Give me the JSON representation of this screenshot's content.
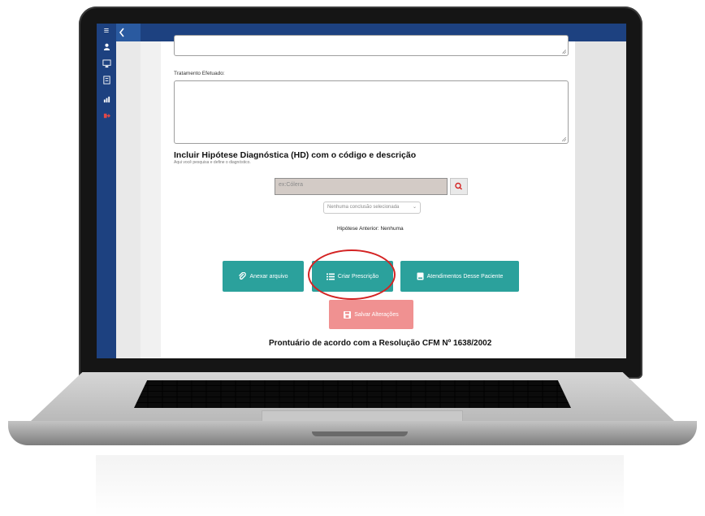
{
  "sidebar": {
    "icons": [
      "menu-icon",
      "user-icon",
      "monitor-icon",
      "records-icon",
      "chart-icon",
      "logout-icon"
    ]
  },
  "form": {
    "treatment_label": "Tratamento Efetuado:",
    "hd_title": "Incluir Hipótese Diagnóstica (HD) com o código e descrição",
    "hd_subtitle": "Aqui você pesquisa e define o diagnóstico.",
    "search_placeholder": "ex:Cólera",
    "conclusion_select": "Nenhuma conclusão selecionada",
    "previous_hypothesis": "Hipótese Anterior: Nenhuma"
  },
  "buttons": {
    "attach": "Anexar arquivo",
    "prescription": "Criar Prescrição",
    "appointments": "Atendimentos Desse Paciente",
    "save": "Salvar Alterações"
  },
  "footer": {
    "note": "Prontuário de acordo com a Resolução CFM Nº 1638/2002"
  },
  "colors": {
    "sidebar": "#1d4180",
    "teal_button": "#2ba19c",
    "save_button": "#f09191",
    "highlight_circle": "#d42323"
  }
}
